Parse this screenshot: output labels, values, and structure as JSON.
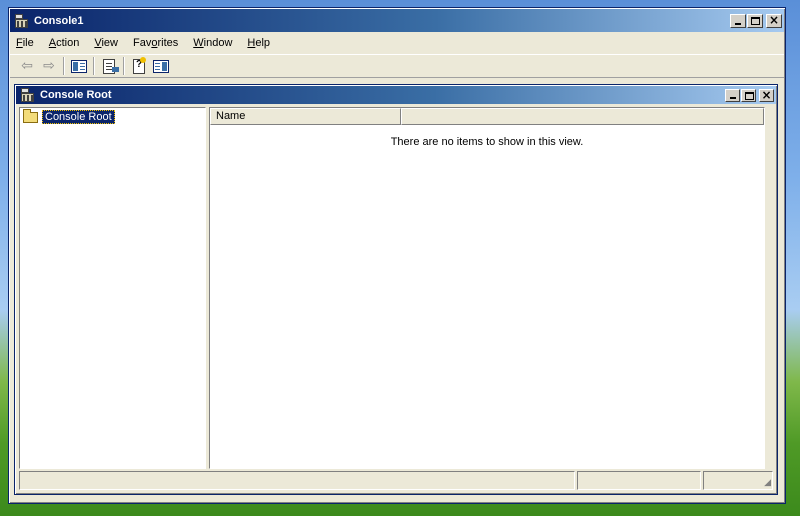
{
  "main_window": {
    "title": "Console1",
    "menu": [
      {
        "label": "File",
        "mnemonic": "F",
        "rest": "ile"
      },
      {
        "label": "Action",
        "mnemonic": "A",
        "rest": "ction"
      },
      {
        "label": "View",
        "mnemonic": "V",
        "rest": "iew"
      },
      {
        "label": "Favorites",
        "mnemonic": "o",
        "pre": "Fav",
        "rest": "rites"
      },
      {
        "label": "Window",
        "mnemonic": "W",
        "rest": "indow"
      },
      {
        "label": "Help",
        "mnemonic": "H",
        "rest": "elp"
      }
    ],
    "toolbar": {
      "back_icon": "back-arrow-icon",
      "forward_icon": "forward-arrow-icon",
      "show_hide_tree_icon": "show-hide-console-tree-icon",
      "export_list_icon": "export-list-icon",
      "help_icon": "help-icon",
      "show_hide_action_pane_icon": "show-hide-action-pane-icon"
    }
  },
  "child_window": {
    "title": "Console Root",
    "tree": {
      "root_label": "Console Root"
    },
    "list": {
      "columns": [
        "Name",
        ""
      ],
      "empty_message": "There are no items to show in this view."
    }
  },
  "colors": {
    "titlebar_start": "#0a246a",
    "titlebar_end": "#a6caf0",
    "window_face": "#ece9d8",
    "selection": "#0a246a"
  }
}
